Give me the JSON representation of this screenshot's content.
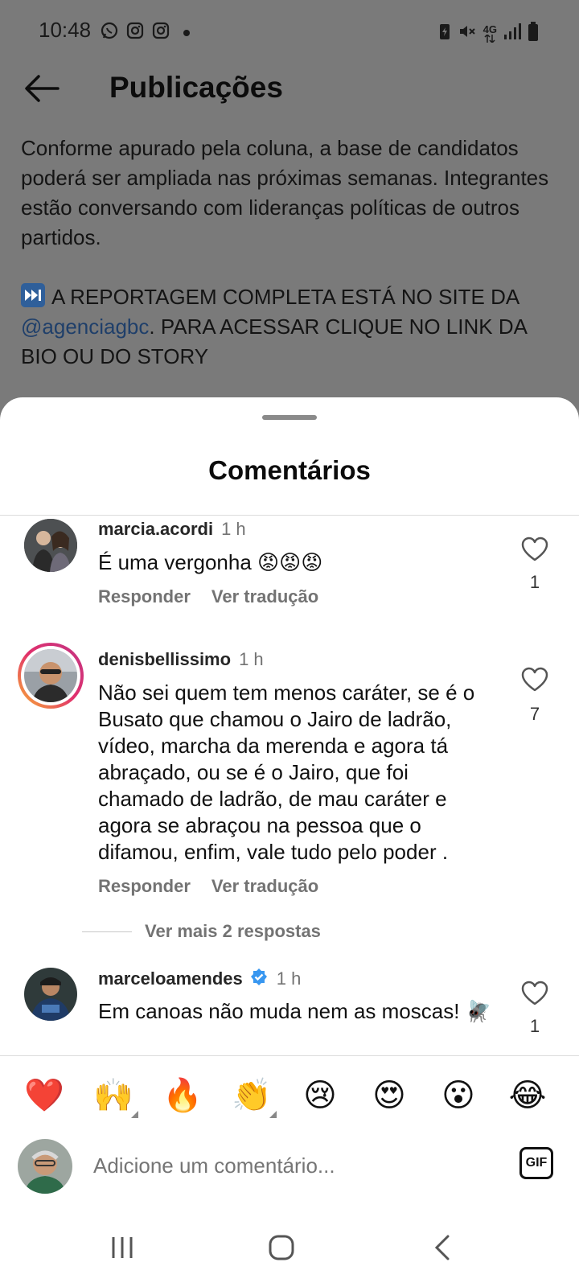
{
  "status_bar": {
    "time": "10:48",
    "network": "4G",
    "left_icons": [
      "whatsapp-icon",
      "instagram-icon",
      "instagram-icon"
    ],
    "right_icons": [
      "battery-saver-icon",
      "mute-icon",
      "network-4g-icon",
      "signal-icon",
      "battery-icon"
    ]
  },
  "header": {
    "title": "Publicações",
    "back_icon": "arrow-left-icon"
  },
  "post": {
    "paragraph_1": "Conforme apurado pela coluna, a base de candidatos poderá ser ampliada nas próximas semanas. Integrantes estão conversando com lideranças políticas de outros partidos.",
    "paragraph_2_lead": "A REPORTAGEM COMPLETA ESTÁ NO SITE DA",
    "paragraph_2_mention": "@agenciagbc",
    "paragraph_2_tail": ". PARA ACESSAR CLIQUE NO LINK DA BIO OU DO STORY"
  },
  "sheet": {
    "title": "Comentários",
    "comments": [
      {
        "username": "marcia.acordi",
        "time": "1 h",
        "text": "É uma vergonha 😡😡😡",
        "reply_label": "Responder",
        "translate_label": "Ver tradução",
        "likes": "1"
      },
      {
        "username": "denisbellissimo",
        "time": "1 h",
        "text": "Não sei quem tem menos caráter, se é o Busato que chamou o Jairo de ladrão, vídeo, marcha da merenda e agora tá abraçado, ou se é o Jairo, que foi chamado de ladrão, de mau caráter e agora se abraçou na pessoa que o difamou, enfim, vale tudo pelo poder .",
        "reply_label": "Responder",
        "translate_label": "Ver tradução",
        "likes": "7",
        "more_replies": "Ver mais 2 respostas"
      },
      {
        "username": "marceloamendes",
        "time": "1 h",
        "text": "Em canoas não muda nem as moscas! 🪰",
        "likes": "1",
        "verified": true
      }
    ]
  },
  "reactions": [
    "❤️",
    "🙌",
    "🔥",
    "👏",
    "😢",
    "😍",
    "😮",
    "😂"
  ],
  "comment_input": {
    "placeholder": "Adicione um comentário...",
    "gif_label": "GIF"
  },
  "nav": [
    "recent-apps-icon",
    "home-icon",
    "back-icon"
  ],
  "colors": {
    "overlay_bg": "#7a7a7a",
    "sheet_bg": "#ffffff",
    "secondary_text": "#737373",
    "verified_blue": "#3897f0"
  }
}
